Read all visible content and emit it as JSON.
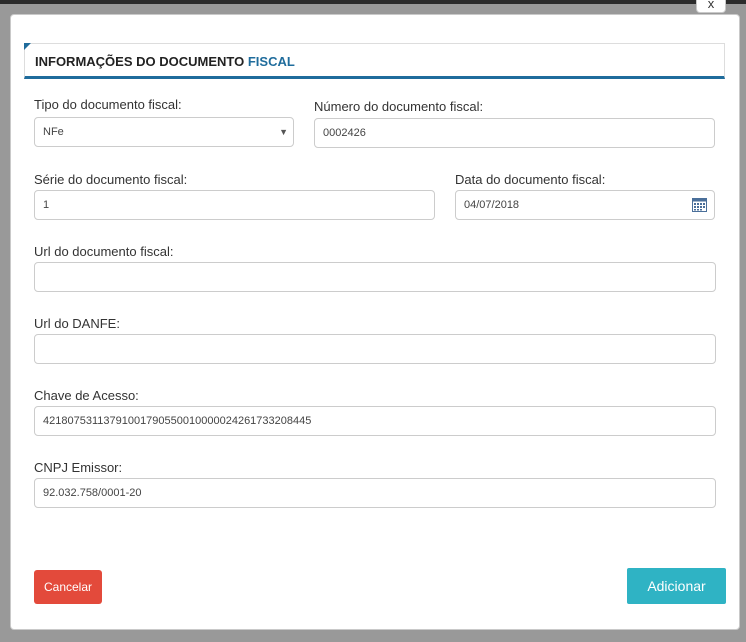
{
  "close_label": "x",
  "section": {
    "title_main": "INFORMAÇÕES DO DOCUMENTO",
    "title_accent": "FISCAL"
  },
  "fields": {
    "tipo": {
      "label": "Tipo do documento fiscal:",
      "value": "NFe"
    },
    "numero": {
      "label": "Número do documento fiscal:",
      "value": "0002426"
    },
    "serie": {
      "label": "Série do documento fiscal:",
      "value": "1"
    },
    "data": {
      "label": "Data do documento fiscal:",
      "value": "04/07/2018"
    },
    "url_doc": {
      "label": "Url do documento fiscal:",
      "value": ""
    },
    "url_danfe": {
      "label": "Url do DANFE:",
      "value": ""
    },
    "chave": {
      "label": "Chave de Acesso:",
      "value": "42180753113791001790550010000024261733208445"
    },
    "cnpj": {
      "label": "CNPJ Emissor:",
      "value": "92.032.758/0001-20"
    }
  },
  "buttons": {
    "cancel": "Cancelar",
    "add": "Adicionar"
  },
  "icons": {
    "close": "close-icon",
    "caret": "chevron-down-icon",
    "calendar": "calendar-icon"
  },
  "colors": {
    "accent": "#1f6c9c",
    "cancel": "#e34a3b",
    "add": "#2fb3c4"
  }
}
